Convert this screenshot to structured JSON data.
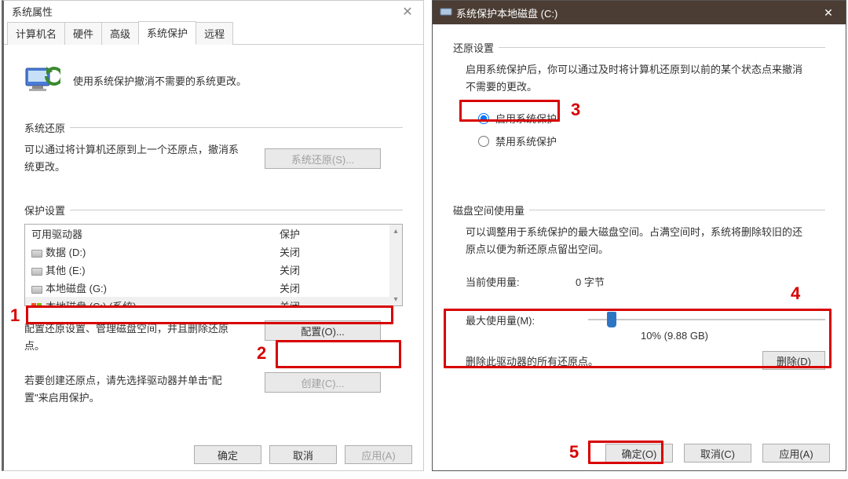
{
  "left": {
    "title": "系统属性",
    "tabs": [
      "计算机名",
      "硬件",
      "高级",
      "系统保护",
      "远程"
    ],
    "active_tab_index": 3,
    "intro": "使用系统保护撤消不需要的系统更改。",
    "restore": {
      "heading": "系统还原",
      "desc": "可以通过将计算机还原到上一个还原点，撤消系统更改。",
      "button": "系统还原(S)..."
    },
    "protect": {
      "heading": "保护设置",
      "col_drive": "可用驱动器",
      "col_status": "保护",
      "drives": [
        {
          "name": "数据 (D:)",
          "status": "关闭",
          "type": "disk"
        },
        {
          "name": "其他 (E:)",
          "status": "关闭",
          "type": "disk"
        },
        {
          "name": "本地磁盘 (G:)",
          "status": "关闭",
          "type": "disk"
        },
        {
          "name": "本地磁盘 (C:) (系统)",
          "status": "关闭",
          "type": "win",
          "selected": true
        }
      ],
      "configure_desc": "配置还原设置、管理磁盘空间，并且删除还原点。",
      "configure_btn": "配置(O)...",
      "create_desc": "若要创建还原点，请先选择驱动器并单击\"配置\"来启用保护。",
      "create_btn": "创建(C)..."
    },
    "footer": {
      "ok": "确定",
      "cancel": "取消",
      "apply": "应用(A)"
    }
  },
  "right": {
    "title": "系统保护本地磁盘 (C:)",
    "restore_heading": "还原设置",
    "restore_desc": "启用系统保护后，你可以通过及时将计算机还原到以前的某个状态点来撤消不需要的更改。",
    "radio_on": "启用系统保护",
    "radio_off": "禁用系统保护",
    "space_heading": "磁盘空间使用量",
    "space_desc": "可以调整用于系统保护的最大磁盘空间。占满空间时，系统将删除较旧的还原点以便为新还原点留出空间。",
    "current_label": "当前使用量:",
    "current_value": "0 字节",
    "max_label": "最大使用量(M):",
    "slider_percent": 10,
    "slider_display": "10% (9.88 GB)",
    "delete_desc": "删除此驱动器的所有还原点。",
    "delete_btn": "删除(D)",
    "footer": {
      "ok": "确定(O)",
      "cancel": "取消(C)",
      "apply": "应用(A)"
    }
  },
  "callouts": {
    "n1": "1",
    "n2": "2",
    "n3": "3",
    "n4": "4",
    "n5": "5"
  }
}
